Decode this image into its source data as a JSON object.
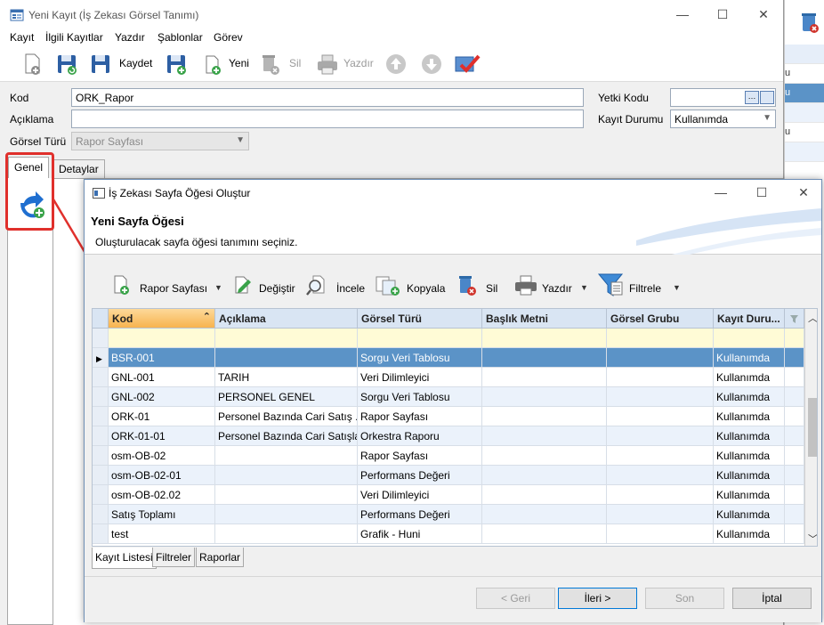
{
  "main_window": {
    "title": "Yeni Kayıt (İş Zekası Görsel Tanımı)",
    "menu": [
      "Kayıt",
      "İlgili Kayıtlar",
      "Yazdır",
      "Şablonlar",
      "Görev"
    ],
    "toolbar": {
      "kaydet": "Kaydet",
      "yeni": "Yeni",
      "sil": "Sil",
      "yazdir": "Yazdır"
    },
    "form": {
      "kod_label": "Kod",
      "kod_value": "ORK_Rapor",
      "aciklama_label": "Açıklama",
      "aciklama_value": "",
      "gorsel_turu_label": "Görsel Türü",
      "gorsel_turu_value": "Rapor Sayfası",
      "yetki_kodu_label": "Yetki Kodu",
      "yetki_kodu_value": "",
      "kayit_durumu_label": "Kayıt Durumu",
      "kayit_durumu_value": "Kullanımda"
    },
    "tabs": [
      "Genel",
      "Detaylar"
    ]
  },
  "dialog": {
    "title": "İş Zekası Sayfa Öğesi Oluştur",
    "header_title": "Yeni Sayfa Öğesi",
    "header_subtitle": "Oluşturulacak sayfa öğesi tanımını seçiniz.",
    "toolbar": {
      "rapor_sayfasi": "Rapor Sayfası",
      "degistir": "Değiştir",
      "incele": "İncele",
      "kopyala": "Kopyala",
      "sil": "Sil",
      "yazdir": "Yazdır",
      "filtrele": "Filtrele"
    },
    "grid": {
      "columns": [
        "Kod",
        "Açıklama",
        "Görsel Türü",
        "Başlık Metni",
        "Görsel Grubu",
        "Kayıt Duru..."
      ],
      "rows": [
        {
          "kod": "BSR-001",
          "aciklama": "",
          "gorsel_turu": "Sorgu Veri Tablosu",
          "baslik": "",
          "grup": "",
          "durum": "Kullanımda"
        },
        {
          "kod": "GNL-001",
          "aciklama": "TARIH",
          "gorsel_turu": "Veri Dilimleyici",
          "baslik": "",
          "grup": "",
          "durum": "Kullanımda"
        },
        {
          "kod": "GNL-002",
          "aciklama": "PERSONEL GENEL",
          "gorsel_turu": "Sorgu Veri Tablosu",
          "baslik": "",
          "grup": "",
          "durum": "Kullanımda"
        },
        {
          "kod": "ORK-01",
          "aciklama": "Personel Bazında Cari Satış ...",
          "gorsel_turu": "Rapor Sayfası",
          "baslik": "",
          "grup": "",
          "durum": "Kullanımda"
        },
        {
          "kod": "ORK-01-01",
          "aciklama": "Personel Bazında Cari Satışlar",
          "gorsel_turu": "Orkestra Raporu",
          "baslik": "",
          "grup": "",
          "durum": "Kullanımda"
        },
        {
          "kod": "osm-OB-02",
          "aciklama": "",
          "gorsel_turu": "Rapor Sayfası",
          "baslik": "",
          "grup": "",
          "durum": "Kullanımda"
        },
        {
          "kod": "osm-OB-02-01",
          "aciklama": "",
          "gorsel_turu": "Performans Değeri",
          "baslik": "",
          "grup": "",
          "durum": "Kullanımda"
        },
        {
          "kod": "osm-OB-02.02",
          "aciklama": "",
          "gorsel_turu": "Veri Dilimleyici",
          "baslik": "",
          "grup": "",
          "durum": "Kullanımda"
        },
        {
          "kod": "Satış Toplamı",
          "aciklama": "",
          "gorsel_turu": "Performans Değeri",
          "baslik": "",
          "grup": "",
          "durum": "Kullanımda"
        },
        {
          "kod": "test",
          "aciklama": "",
          "gorsel_turu": "Grafik - Huni",
          "baslik": "",
          "grup": "",
          "durum": "Kullanımda"
        }
      ]
    },
    "bottom_tabs": [
      "Kayıt Listesi",
      "Filtreler",
      "Raporlar"
    ],
    "buttons": {
      "geri": "< Geri",
      "ileri": "İleri >",
      "son": "Son",
      "iptal": "İptal"
    }
  },
  "background_window": {
    "cell_a": "u",
    "cell_b": "u",
    "cell_c": "u"
  },
  "colors": {
    "selection": "#5b93c7",
    "header": "#d9e5f3",
    "highlight_red": "#e0302c"
  }
}
